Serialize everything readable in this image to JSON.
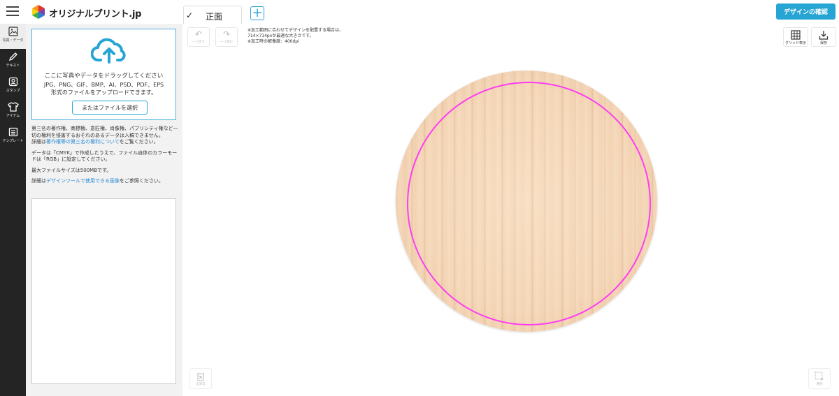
{
  "header": {
    "logo_text": "オリジナルプリント.jp",
    "tab_label": "正面",
    "add_tab": "+",
    "confirm_label": "デザインの確認"
  },
  "rail": {
    "items": [
      {
        "label": "写真・データ",
        "icon": "image-icon"
      },
      {
        "label": "テキスト",
        "icon": "pencil-icon"
      },
      {
        "label": "スタンプ",
        "icon": "stamp-icon"
      },
      {
        "label": "アイテム",
        "icon": "tshirt-icon"
      },
      {
        "label": "テンプレート",
        "icon": "template-icon"
      }
    ]
  },
  "upload": {
    "drag_text": "ここに写真やデータをドラッグしてください",
    "formats_line1": "JPG、PNG、GIF、BMP、AI、PSD、PDF、EPS",
    "formats_line2": "形式のファイルをアップロードできます。",
    "select_label": "またはファイルを選択"
  },
  "notes": {
    "rights": "第三名の著作権、商標権、意匠権、肖像権、パブリシティ権など一切の権利を侵害するおそれのあるデータは入稿できません。",
    "details_prefix": "詳細は",
    "rights_link": "著作権等の第三名の権利について",
    "details_suffix": "をご覧ください。",
    "cmyk": "データは「CMYK」で作成したうえで、ファイル自体のカラーモードは「RGB」に設定してください。",
    "max_size": "最大ファイルサイズは500MBです。",
    "images_prefix": "詳細は",
    "images_link": "デザインツールで使用できる画像",
    "images_suffix": "をご参照ください。"
  },
  "canvas": {
    "undo_label": "一つ戻す",
    "redo_label": "一つ進む",
    "info_line1": "※加工範囲に合わせてデザインを配置する場合は、",
    "info_line2": "714×714pxが最適な大きさです。",
    "info_line3": "※加工時の解像度：400dpi",
    "grid_label": "グリッド表示",
    "save_label": "保存",
    "delete_all_label": "全消去",
    "select_label": "選択"
  },
  "colors": {
    "accent": "#26a5d4",
    "rail_bg": "#242424",
    "guide_ring": "#ff3df2"
  }
}
